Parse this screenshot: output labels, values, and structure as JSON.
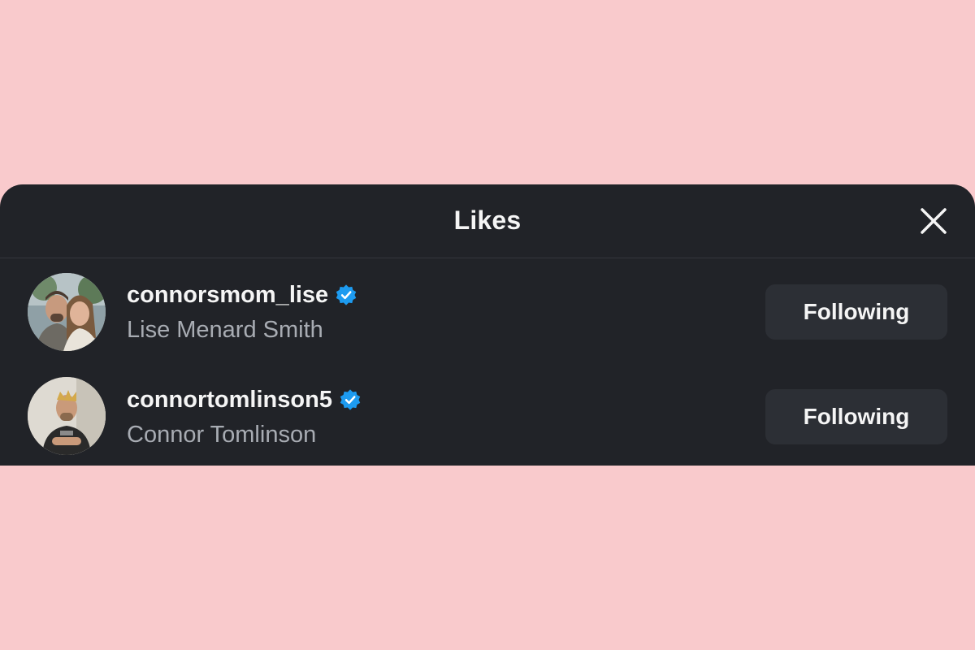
{
  "modal": {
    "title": "Likes",
    "close_icon": "close-icon"
  },
  "users": [
    {
      "username": "connorsmom_lise",
      "full_name": "Lise Menard Smith",
      "verified": true,
      "button_label": "Following"
    },
    {
      "username": "connortomlinson5",
      "full_name": "Connor Tomlinson",
      "verified": true,
      "button_label": "Following"
    }
  ],
  "colors": {
    "page_background": "#f9cacc",
    "modal_background": "#212328",
    "verified_badge": "#1d9bf0",
    "button_background": "#2c2f35",
    "secondary_text": "#a8acb3"
  }
}
